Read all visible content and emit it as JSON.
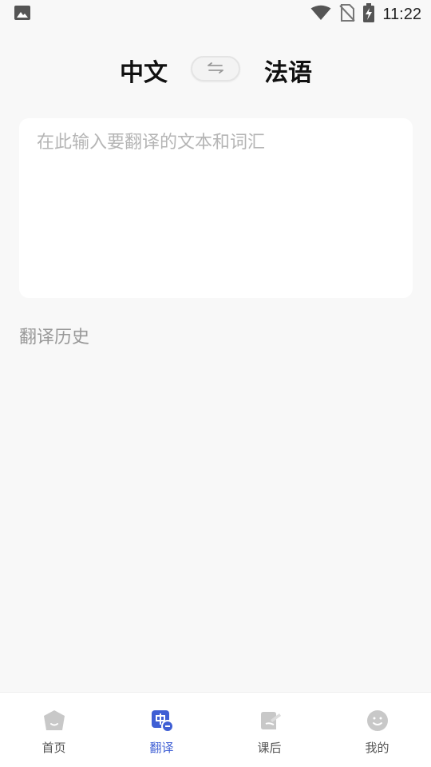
{
  "status_bar": {
    "time": "11:22",
    "icons": [
      "image-icon",
      "wifi-icon",
      "no-sim-icon",
      "battery-charging-icon"
    ]
  },
  "language": {
    "source": "中文",
    "target": "法语",
    "swap_icon": "swap-arrows-icon"
  },
  "input": {
    "placeholder": "在此输入要翻译的文本和词汇",
    "value": ""
  },
  "history": {
    "title": "翻译历史"
  },
  "bottom_nav": {
    "active_index": 1,
    "active_color": "#3f5fd4",
    "inactive_color": "#c8c8c8",
    "items": [
      {
        "label": "首页",
        "icon": "home-icon"
      },
      {
        "label": "翻译",
        "icon": "translate-icon"
      },
      {
        "label": "课后",
        "icon": "homework-icon"
      },
      {
        "label": "我的",
        "icon": "profile-icon"
      }
    ]
  }
}
